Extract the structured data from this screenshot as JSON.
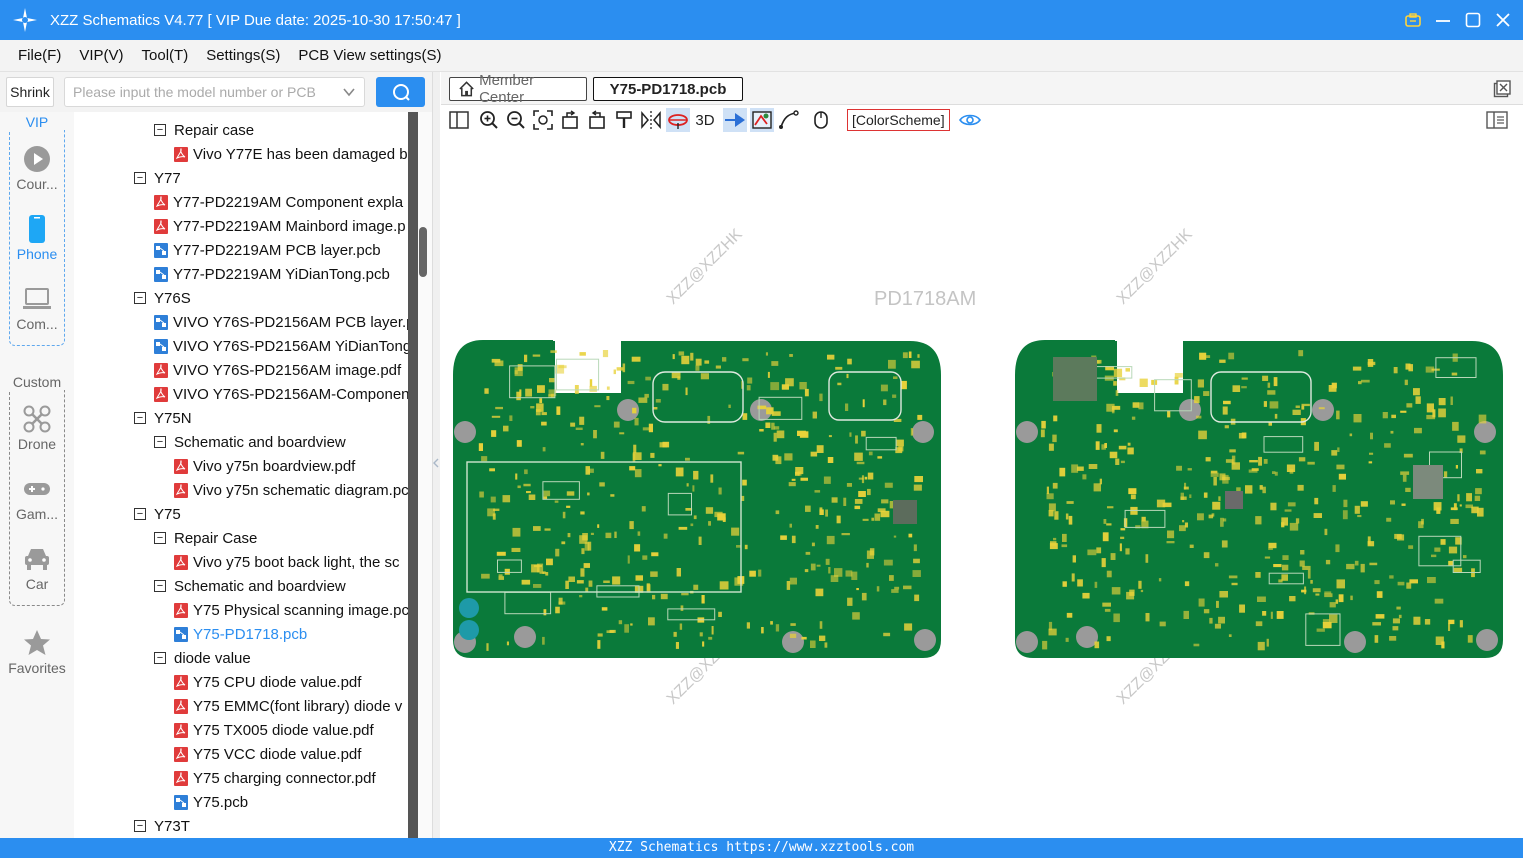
{
  "titlebar": {
    "title": "XZZ Schematics V4.77 [ VIP Due date: 2025-10-30 17:50:47 ]"
  },
  "menu": [
    "File(F)",
    "VIP(V)",
    "Tool(T)",
    "Settings(S)",
    "PCB View settings(S)"
  ],
  "search": {
    "shrink_label": "Shrink",
    "placeholder": "Please input the model number or PCB"
  },
  "rail": {
    "vip_label": "VIP",
    "custom_label": "Custom",
    "items": [
      {
        "label": "Cour...",
        "icon": "play-icon"
      },
      {
        "label": "Phone",
        "icon": "phone-icon"
      },
      {
        "label": "Com...",
        "icon": "laptop-icon"
      },
      {
        "label": "Drone",
        "icon": "drone-icon"
      },
      {
        "label": "Gam...",
        "icon": "gamepad-icon"
      },
      {
        "label": "Car",
        "icon": "car-icon"
      },
      {
        "label": "Favorites",
        "icon": "star-icon"
      }
    ]
  },
  "tree": [
    {
      "level": 2,
      "type": "folder",
      "label": "Repair case"
    },
    {
      "level": 3,
      "type": "pdf",
      "label": "Vivo Y77E has been damaged b"
    },
    {
      "level": 1,
      "type": "folder",
      "label": "Y77"
    },
    {
      "level": 2,
      "type": "pdf",
      "label": "Y77-PD2219AM Component expla"
    },
    {
      "level": 2,
      "type": "pdf",
      "label": "Y77-PD2219AM Mainbord image.p"
    },
    {
      "level": 2,
      "type": "pcb",
      "label": "Y77-PD2219AM PCB layer.pcb"
    },
    {
      "level": 2,
      "type": "pcb",
      "label": "Y77-PD2219AM YiDianTong.pcb"
    },
    {
      "level": 1,
      "type": "folder",
      "label": "Y76S"
    },
    {
      "level": 2,
      "type": "pcb",
      "label": "VIVO Y76S-PD2156AM PCB layer.p"
    },
    {
      "level": 2,
      "type": "pcb",
      "label": "VIVO Y76S-PD2156AM YiDianTong"
    },
    {
      "level": 2,
      "type": "pdf",
      "label": "VIVO Y76S-PD2156AM image.pdf"
    },
    {
      "level": 2,
      "type": "pdf",
      "label": "VIVO Y76S-PD2156AM-Componen"
    },
    {
      "level": 1,
      "type": "folder",
      "label": "Y75N"
    },
    {
      "level": 2,
      "type": "folder",
      "label": "Schematic and boardview"
    },
    {
      "level": 3,
      "type": "pdf",
      "label": "Vivo y75n boardview.pdf"
    },
    {
      "level": 3,
      "type": "pdf",
      "label": "Vivo y75n schematic diagram.pc"
    },
    {
      "level": 1,
      "type": "folder",
      "label": "Y75"
    },
    {
      "level": 2,
      "type": "folder",
      "label": "Repair Case"
    },
    {
      "level": 3,
      "type": "pdf",
      "label": "Vivo y75 boot back light, the sc"
    },
    {
      "level": 2,
      "type": "folder",
      "label": "Schematic and boardview"
    },
    {
      "level": 3,
      "type": "pdf",
      "label": "Y75 Physical scanning image.pc"
    },
    {
      "level": 3,
      "type": "pcb",
      "label": "Y75-PD1718.pcb",
      "active": true
    },
    {
      "level": 2,
      "type": "folder",
      "label": "diode value"
    },
    {
      "level": 3,
      "type": "pdf",
      "label": "Y75 CPU diode value.pdf"
    },
    {
      "level": 3,
      "type": "pdf",
      "label": "Y75 EMMC(font library) diode v"
    },
    {
      "level": 3,
      "type": "pdf",
      "label": "Y75 TX005 diode value.pdf"
    },
    {
      "level": 3,
      "type": "pdf",
      "label": "Y75 VCC diode value.pdf"
    },
    {
      "level": 3,
      "type": "pdf",
      "label": "Y75 charging connector.pdf"
    },
    {
      "level": 3,
      "type": "pcb",
      "label": "Y75.pcb"
    },
    {
      "level": 1,
      "type": "folder",
      "label": "Y73T"
    }
  ],
  "tabs": {
    "member_label": "Member Center",
    "active_label": "Y75-PD1718.pcb"
  },
  "toolbar": {
    "three_d_label": "3D",
    "colorscheme_label": "[ColorScheme]"
  },
  "canvas": {
    "board_title": "PD1718AM",
    "watermark": "XZZ@XZZHK",
    "board_color": "#0a7a3a",
    "pad_color": "#e8d23a"
  },
  "status": {
    "text": "XZZ Schematics https://www.xzztools.com"
  }
}
